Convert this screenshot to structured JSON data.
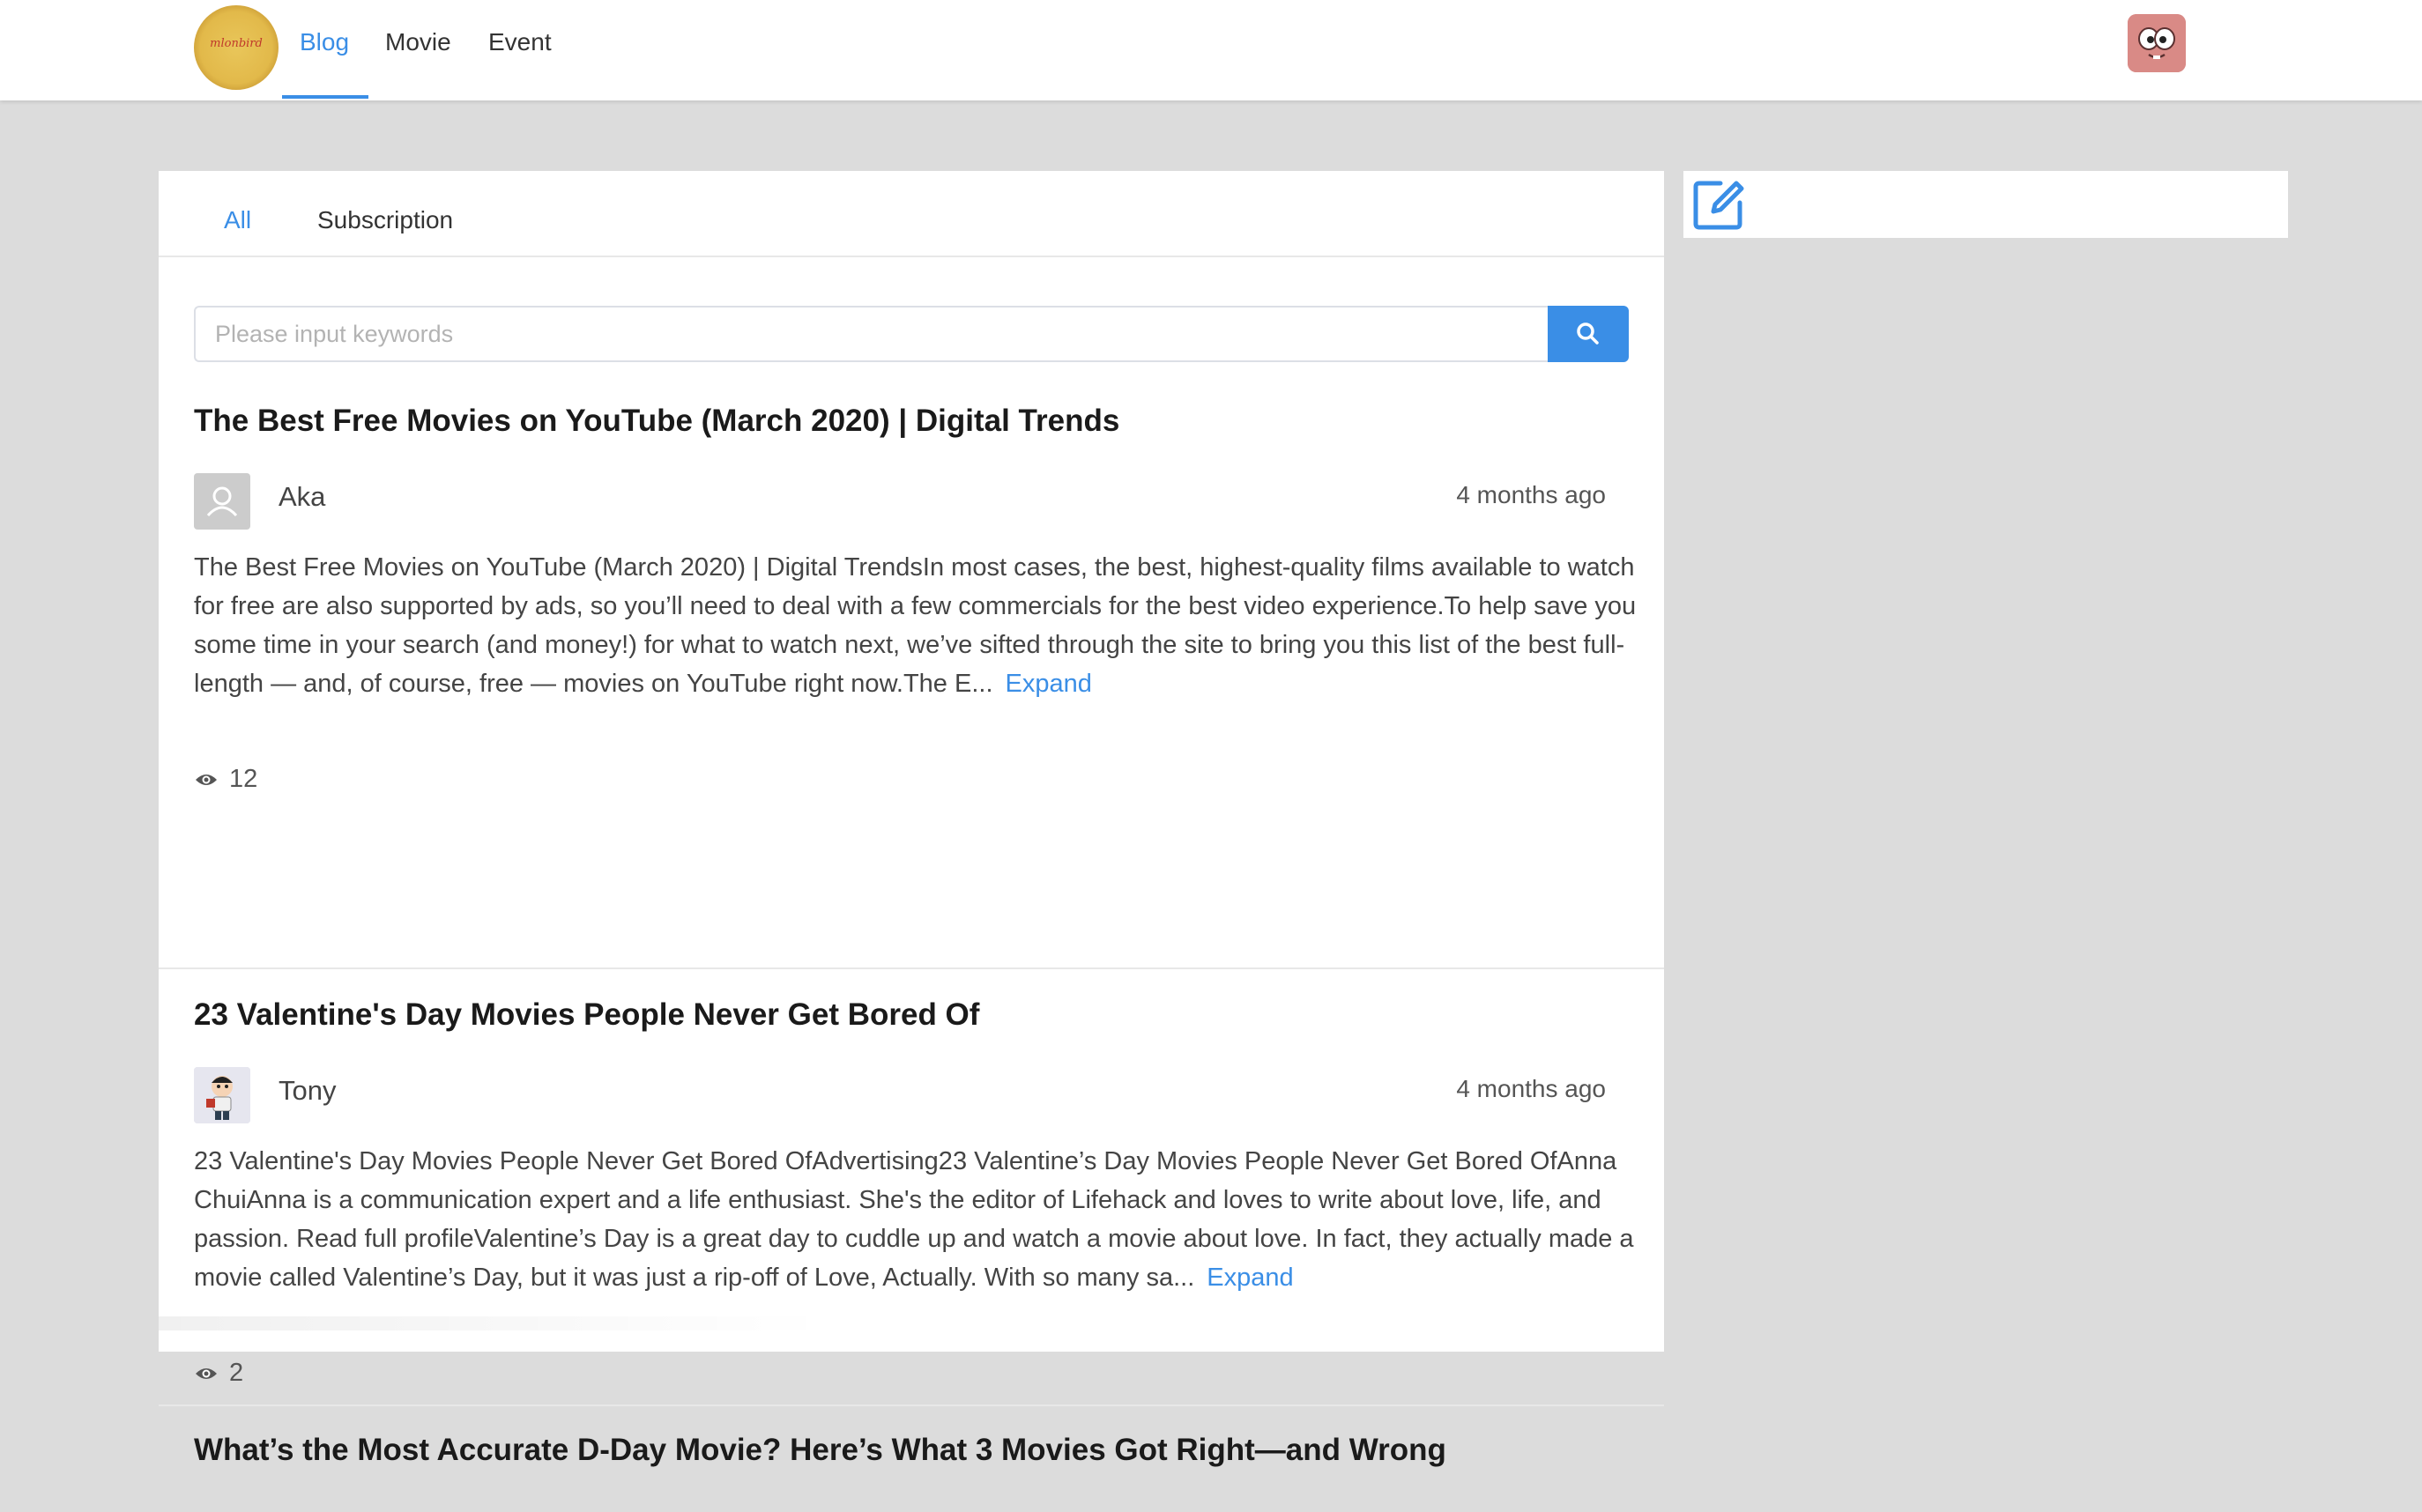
{
  "nav": {
    "logo_text": "mlonbird",
    "items": [
      {
        "label": "Blog",
        "active": true
      },
      {
        "label": "Movie",
        "active": false
      },
      {
        "label": "Event",
        "active": false
      }
    ],
    "accent_color": "#3a8ee6"
  },
  "tabs": [
    {
      "label": "All",
      "active": true
    },
    {
      "label": "Subscription",
      "active": false
    }
  ],
  "search": {
    "placeholder": "Please input keywords",
    "value": "",
    "button_icon": "search-icon"
  },
  "posts": [
    {
      "title": "The Best Free Movies on YouTube (March 2020) | Digital Trends",
      "author": "Aka",
      "avatar_icon": "default-user-icon",
      "time": "4 months ago",
      "excerpt": "The Best Free Movies on YouTube (March 2020) | Digital TrendsIn most cases, the best, highest-quality films available to watch for free are also supported by ads, so you’ll need to deal with a few commercials for the best video experience.To help save you some time in your search (and money!) for what to watch next, we’ve sifted through the site to bring you this list of the best full-length — and, of course, free — movies on YouTube right now.The E...",
      "expand_label": "Expand",
      "views": "12"
    },
    {
      "title": "23 Valentine's Day Movies People Never Get Bored Of",
      "author": "Tony",
      "avatar_icon": "cartoon-avatar",
      "time": "4 months ago",
      "excerpt": "23 Valentine's Day Movies People Never Get Bored OfAdvertising23 Valentine’s Day Movies People Never Get Bored OfAnna ChuiAnna is a communication expert and a life enthusiast. She's the editor of Lifehack and loves to write about love, life, and passion. Read full profileValentine’s Day is a great day to cuddle up and watch a movie about love. In fact, they actually made a movie called Valentine’s Day, but it was just a rip-off of Love, Actually. With so many sa...",
      "expand_label": "Expand",
      "views": "2"
    },
    {
      "title": "What’s the Most Accurate D-Day Movie? Here’s What 3 Movies Got Right—and Wrong"
    }
  ],
  "side": {
    "icon": "edit-icon"
  }
}
